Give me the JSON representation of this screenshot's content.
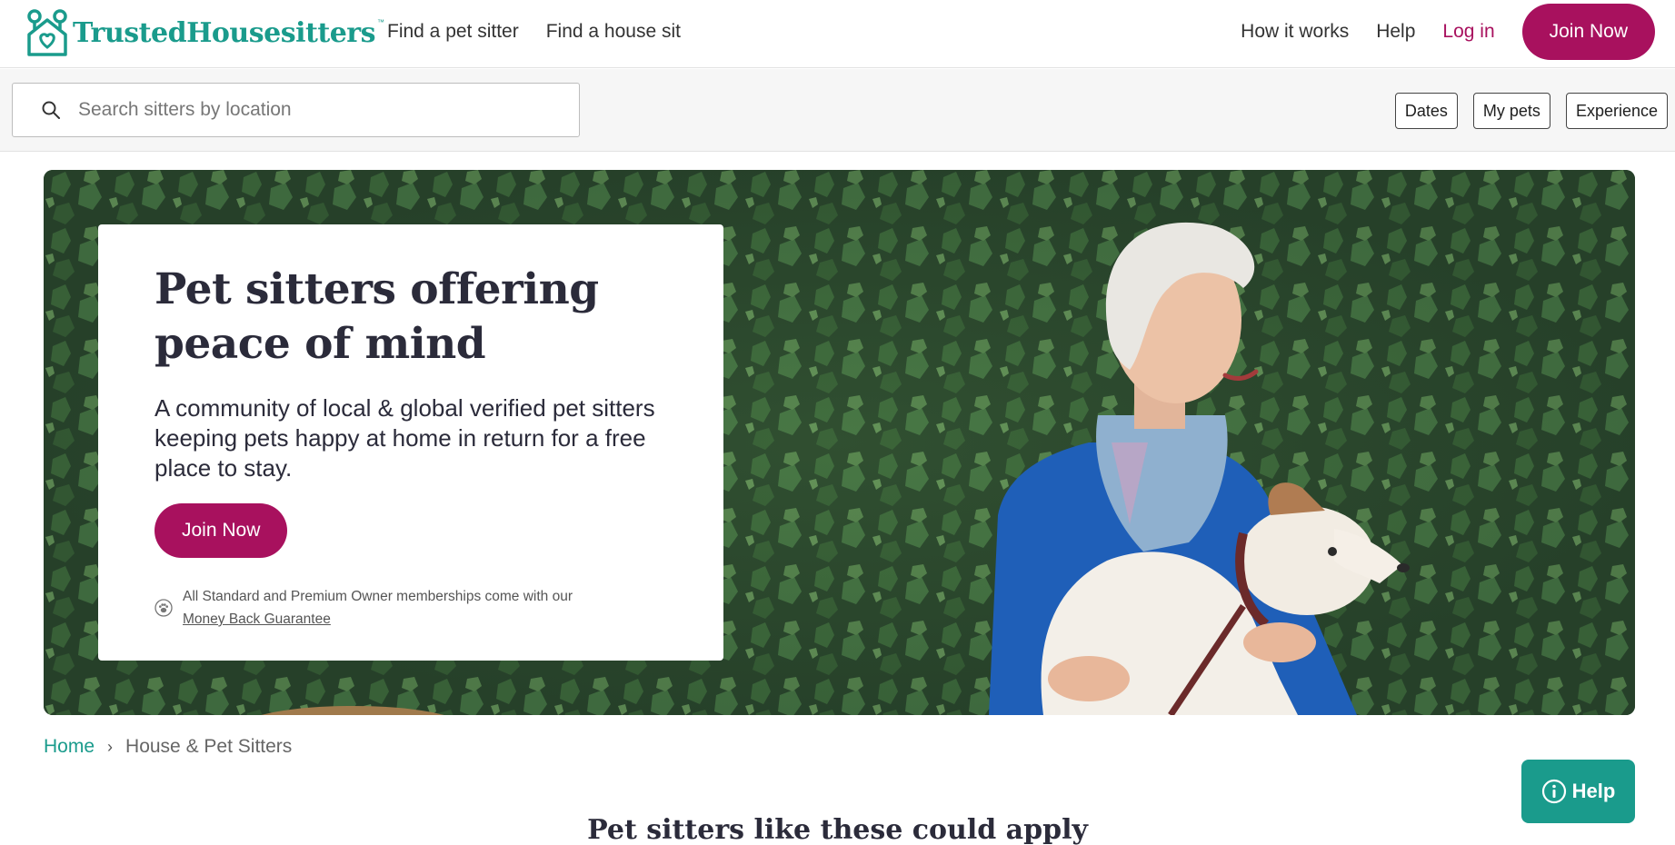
{
  "header": {
    "logo_text": "TrustedHousesitters",
    "logo_tm": "™",
    "nav_left": [
      "Find a pet sitter",
      "Find a house sit"
    ],
    "how_it_works": "How it works",
    "help": "Help",
    "login": "Log in",
    "join": "Join Now"
  },
  "search": {
    "placeholder": "Search sitters by location",
    "value": "",
    "filters": [
      "Dates",
      "My pets",
      "Experience"
    ]
  },
  "hero": {
    "title_line1": "Pet sitters offering",
    "title_line2": "peace of mind",
    "subtitle": "A community of local & global verified pet sitters keeping pets happy at home in return for a free place to stay.",
    "join": "Join Now",
    "guarantee_text": "All Standard and Premium Owner memberships come with our",
    "guarantee_link": "Money Back Guarantee"
  },
  "breadcrumb": {
    "home": "Home",
    "separator": "›",
    "current": "House & Pet Sitters"
  },
  "section": {
    "title": "Pet sitters like these could apply"
  },
  "help_widget": {
    "label": "Help"
  },
  "colors": {
    "brand_teal": "#1a9b8c",
    "brand_magenta": "#a8115e",
    "ivy_green": "#2d4a2e"
  }
}
